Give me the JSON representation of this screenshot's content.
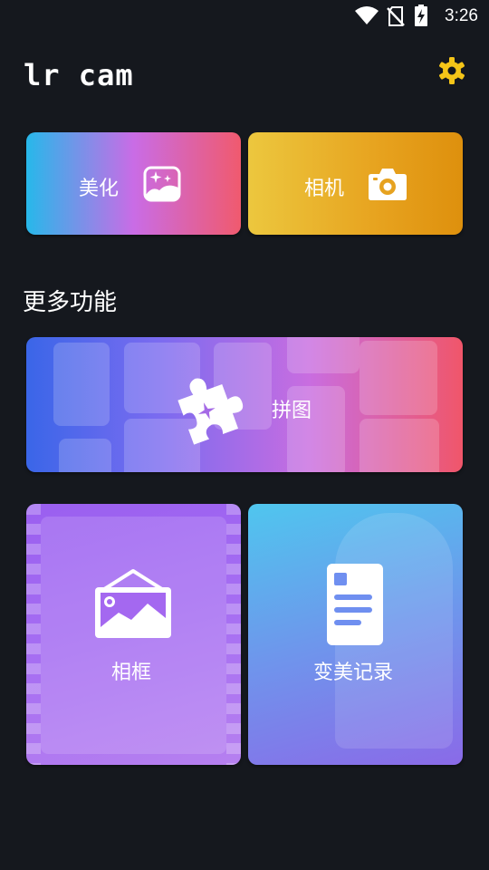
{
  "status_bar": {
    "time": "3:26",
    "icons": [
      "wifi-icon",
      "no-sim-icon",
      "battery-charging-icon"
    ]
  },
  "header": {
    "title": "lr cam",
    "settings_icon": "gear-icon"
  },
  "main_actions": {
    "beautify": {
      "label": "美化",
      "icon": "image-sparkle-icon"
    },
    "camera": {
      "label": "相机",
      "icon": "camera-icon"
    }
  },
  "more_features": {
    "title": "更多功能",
    "collage": {
      "label": "拼图",
      "icon": "puzzle-icon"
    },
    "frame": {
      "label": "相框",
      "icon": "framed-picture-icon"
    },
    "history": {
      "label": "变美记录",
      "icon": "document-icon"
    }
  },
  "colors": {
    "background": "#15181e",
    "settings": "#f5c518"
  }
}
